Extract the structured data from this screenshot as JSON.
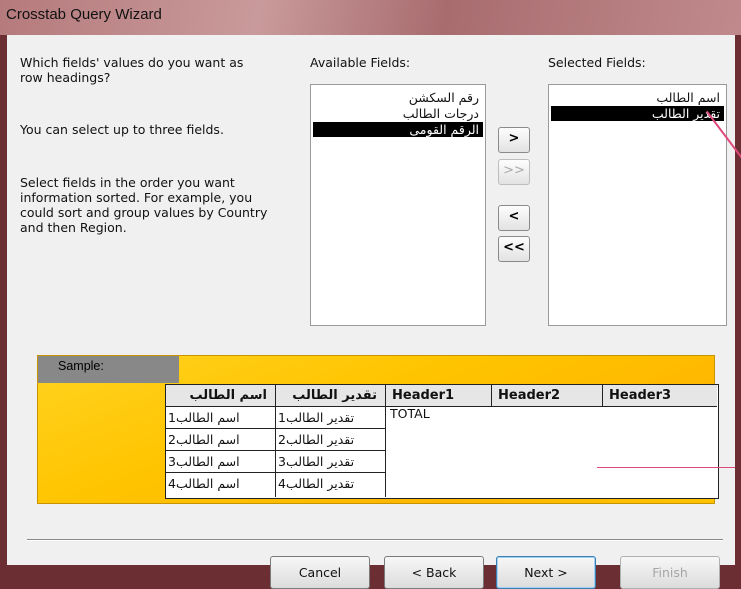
{
  "window": {
    "title": "Crosstab Query Wizard"
  },
  "instructions": {
    "line1": "Which fields' values do you want as",
    "line2": "row headings?",
    "line3": "You can select up to three fields.",
    "line4": "Select fields in the order you want",
    "line5": "information sorted.  For example, you",
    "line6": "could sort and group values by Country",
    "line7": "and then Region."
  },
  "available": {
    "label": "Available Fields:",
    "items": [
      "رقم السكشن",
      "درجات الطالب",
      "الرقم القومى"
    ],
    "selected_index": 2
  },
  "selected": {
    "label": "Selected Fields:",
    "items": [
      "اسم الطالب",
      "تقدير الطالب"
    ],
    "selected_index": 1
  },
  "move_buttons": {
    "add": ">",
    "add_all": ">>",
    "remove": "<",
    "remove_all": "<<"
  },
  "sample": {
    "label": "Sample:",
    "headers": [
      "اسم الطالب",
      "تقدير الطالب",
      "Header1",
      "Header2",
      "Header3"
    ],
    "rows": [
      [
        "1اسم الطالب",
        "1تقدير الطالب"
      ],
      [
        "2اسم الطالب",
        "2تقدير الطالب"
      ],
      [
        "3اسم الطالب",
        "3تقدير الطالب"
      ],
      [
        "4اسم الطالب",
        "4تقدير الطالب"
      ]
    ],
    "total": "TOTAL"
  },
  "buttons": {
    "cancel": "Cancel",
    "back": "< Back",
    "next": "Next >",
    "finish": "Finish"
  },
  "colors": {
    "sample_bg": "#ffc400",
    "selection": "#000000",
    "annotation": "#e0487c"
  }
}
